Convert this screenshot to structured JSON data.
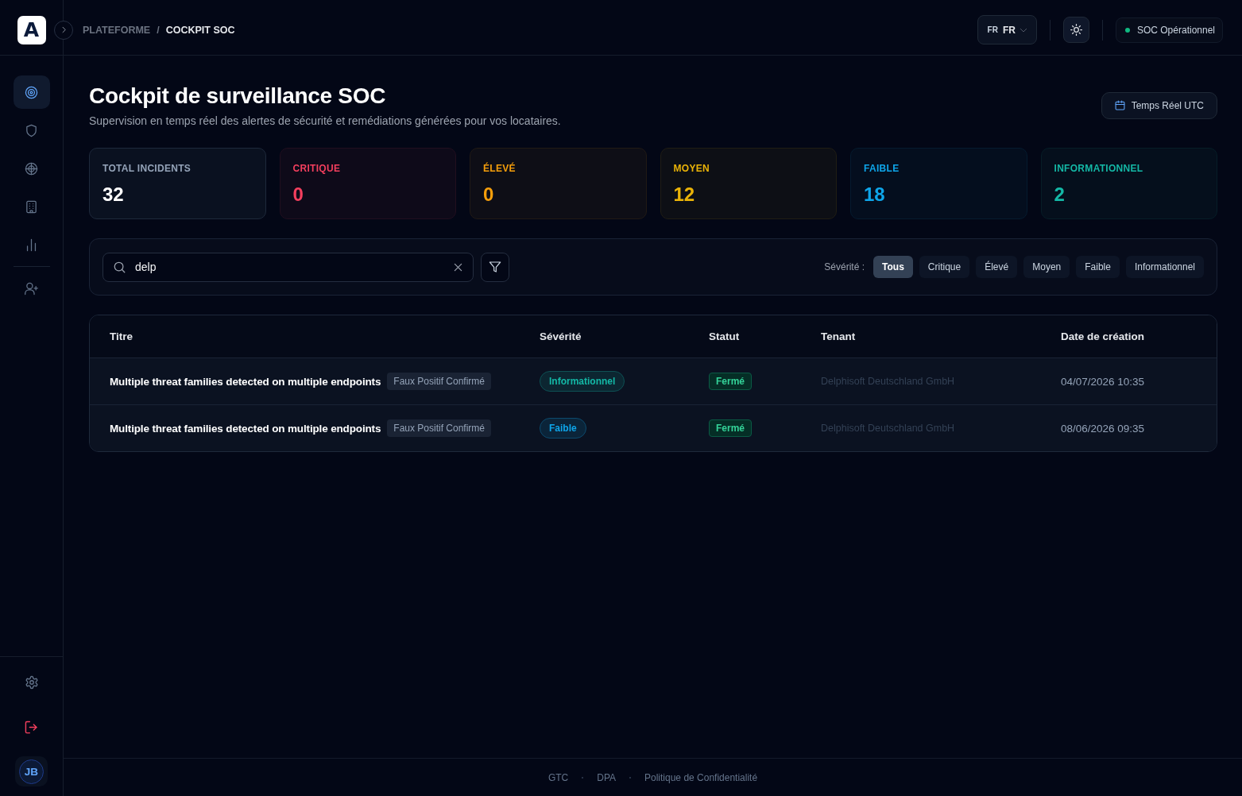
{
  "brand": {
    "mark": "A"
  },
  "header": {
    "breadcrumb": {
      "separator": "/",
      "items": [
        {
          "label": "PLATEFORME",
          "current": false
        },
        {
          "label": "COCKPIT SOC",
          "current": true
        }
      ]
    },
    "language": {
      "flag": "FR",
      "label": "FR"
    },
    "status": {
      "label": "SOC Opérationnel",
      "online": true
    }
  },
  "sidebar": {
    "primary": [
      {
        "selected": true
      },
      {
        "selected": false
      },
      {
        "selected": false
      },
      {
        "selected": false
      },
      {
        "selected": false
      }
    ],
    "secondary": [
      {
        "selected": false
      }
    ],
    "user": {
      "initials": "JB"
    }
  },
  "page": {
    "title": "Cockpit de surveillance SOC",
    "subtitle": "Supervision en temps réel des alertes de sécurité et remédiations générées pour vos locataires.",
    "time_button": "Temps Réel UTC"
  },
  "stats": [
    {
      "kind": "total",
      "label": "TOTAL INCIDENTS",
      "value": "32",
      "color": "#ffffff"
    },
    {
      "kind": "severity",
      "label": "CRITIQUE",
      "value": "0",
      "color": "#f43f5e"
    },
    {
      "kind": "severity",
      "label": "ÉLEVÉ",
      "value": "0",
      "color": "#f59e0b"
    },
    {
      "kind": "severity",
      "label": "MOYEN",
      "value": "12",
      "color": "#eab308"
    },
    {
      "kind": "severity",
      "label": "FAIBLE",
      "value": "18",
      "color": "#0ea5e9"
    },
    {
      "kind": "severity",
      "label": "INFORMATIONNEL",
      "value": "2",
      "color": "#14b8a6"
    }
  ],
  "filters": {
    "search": {
      "value": "delp"
    },
    "severity_label": "Sévérité :",
    "chips": [
      {
        "label": "Tous",
        "selected": true
      },
      {
        "label": "Critique",
        "selected": false
      },
      {
        "label": "Élevé",
        "selected": false
      },
      {
        "label": "Moyen",
        "selected": false
      },
      {
        "label": "Faible",
        "selected": false
      },
      {
        "label": "Informationnel",
        "selected": false
      }
    ]
  },
  "table": {
    "columns": [
      "Titre",
      "Sévérité",
      "Statut",
      "Tenant",
      "Date de création"
    ],
    "rows": [
      {
        "title": "Multiple threat families detected on multiple endpoints",
        "tag": "Faux Positif Confirmé",
        "severity": {
          "label": "Informationnel",
          "color": "#14b8a6"
        },
        "status": "Fermé",
        "tenant": "Delphisoft Deutschland GmbH",
        "created": "04/07/2026 10:35"
      },
      {
        "title": "Multiple threat families detected on multiple endpoints",
        "tag": "Faux Positif Confirmé",
        "severity": {
          "label": "Faible",
          "color": "#0ea5e9"
        },
        "status": "Fermé",
        "tenant": "Delphisoft Deutschland GmbH",
        "created": "08/06/2026 09:35"
      }
    ]
  },
  "footer": {
    "links": [
      "GTC",
      "DPA",
      "Politique de Confidentialité"
    ]
  }
}
